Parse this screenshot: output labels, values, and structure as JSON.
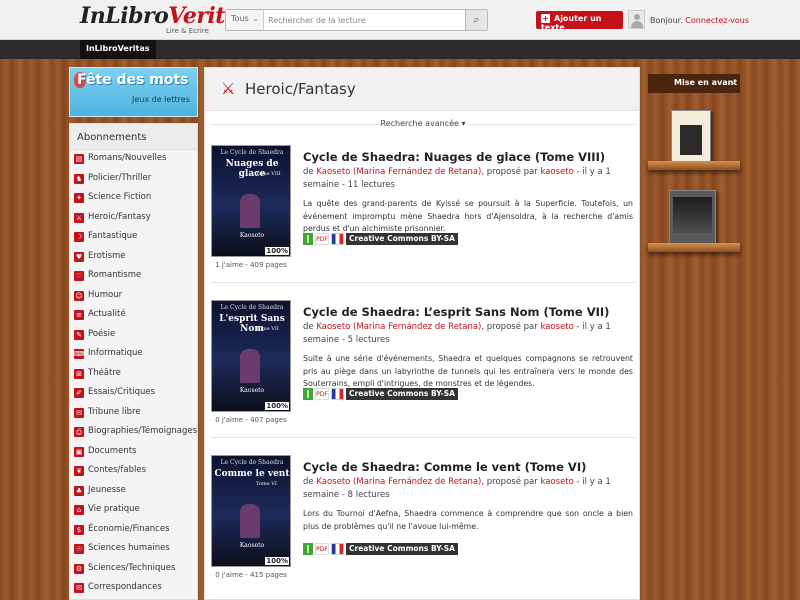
{
  "header": {
    "logo_part1": "InLibro",
    "logo_part2": "Veritas",
    "logo_tagline": "Lire & Ecrire",
    "search_category": "Tous",
    "search_placeholder": "Rechercher de la lecture",
    "add_text_label": "Ajouter un texte",
    "greeting": "Bonjour.",
    "connect_label": "Connectez-vous"
  },
  "nav": {
    "active_tab": "InLibroVeritas"
  },
  "banner": {
    "title": "Fête des mots",
    "subtitle": "Jeux de lettres"
  },
  "sidebar": {
    "title": "Abonnements",
    "items": [
      "Romans/Nouvelles",
      "Policier/Thriller",
      "Science Fiction",
      "Heroic/Fantasy",
      "Fantastique",
      "Erotisme",
      "Romantisme",
      "Humour",
      "Actualité",
      "Poésie",
      "Informatique",
      "Théâtre",
      "Essais/Critiques",
      "Tribune libre",
      "Biographies/Témoignages",
      "Documents",
      "Contes/fables",
      "Jeunesse",
      "Vie pratique",
      "Économie/Finances",
      "Sciences humaines",
      "Sciences/Techniques",
      "Correspondances"
    ]
  },
  "main": {
    "category_title": "Heroic/Fantasy",
    "advanced_search": "Recherche avancée ▾",
    "books": [
      {
        "title": "Cycle de Shaedra: Nuages de glace (Tome VIII)",
        "meta_de": "de ",
        "author": "Kaoseto (Marina Fernández de Retana)",
        "meta_by": ", proposé par ",
        "proposer": "kaoseto",
        "meta_time": " - il y a 1 semaine - 11 lectures",
        "description": "La quête des grand-parents de Kyissé se poursuit à la Superficie. Toutefois, un événement impromptu mène Shaedra hors d'Ajensoldra, à la recherche d'amis perdus et d'un alchimiste prisonnier.",
        "stats": "1 j'aime - 409 pages",
        "cover_series": "Le Cycle de Shaedra",
        "cover_title": "Nuages de glace",
        "cover_tome": "Tome VIII",
        "cover_author": "Kaoseto",
        "progress": "100%",
        "license": "Creative Commons BY-SA"
      },
      {
        "title": "Cycle de Shaedra: L’esprit Sans Nom (Tome VII)",
        "meta_de": "de ",
        "author": "Kaoseto (Marina Fernández de Retana)",
        "meta_by": ", proposé par ",
        "proposer": "kaoseto",
        "meta_time": " - il y a 1 semaine - 5 lectures",
        "description": "Suite à une série d'événements, Shaedra et quelques compagnons se retrouvent pris au piège dans un labyrinthe de tunnels qui les entraînera vers le monde des Souterrains, empli d'intrigues, de monstres et de légendes.",
        "stats": "0 j'aime - 407 pages",
        "cover_series": "Le Cycle de Shaedra",
        "cover_title": "L'esprit Sans Nom",
        "cover_tome": "Tome VII",
        "cover_author": "Kaoseto",
        "progress": "100%",
        "license": "Creative Commons BY-SA"
      },
      {
        "title": "Cycle de Shaedra: Comme le vent (Tome VI)",
        "meta_de": "de ",
        "author": "Kaoseto (Marina Fernández de Retana)",
        "meta_by": ", proposé par ",
        "proposer": "kaoseto",
        "meta_time": " - il y a 1 semaine - 8 lectures",
        "description": "Lors du Tournoi d'Aefna, Shaedra commence à comprendre que son oncle a bien plus de problèmes qu'il ne l'avoue lui-même.",
        "stats": "0 j'aime - 415 pages",
        "cover_series": "Le Cycle de Shaedra",
        "cover_title": "Comme le vent",
        "cover_tome": "Tome VI",
        "cover_author": "Kaoseto",
        "progress": "100%",
        "license": "Creative Commons BY-SA"
      }
    ]
  },
  "right": {
    "shelf_title": "Mise en avant"
  },
  "colors": {
    "brand_red": "#c4111b",
    "wood": "#8a4a22"
  }
}
